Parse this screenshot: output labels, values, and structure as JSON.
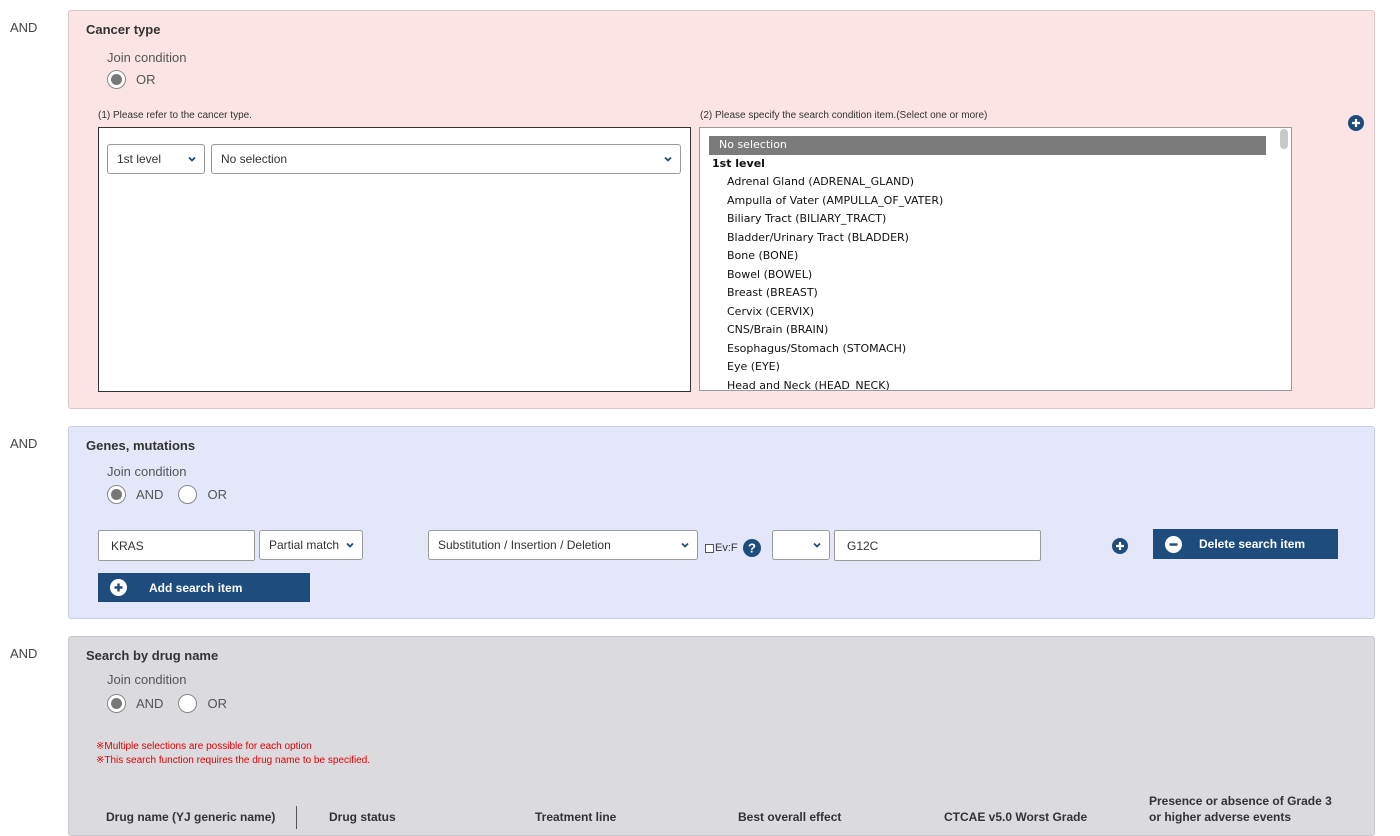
{
  "cancer_section": {
    "and_label": "AND",
    "title": "Cancer type",
    "join_label": "Join condition",
    "radio_or": "OR",
    "step1_label": "(1) Please refer to the cancer type.",
    "step2_label": "(2) Please specify the search condition item.(Select one or more)",
    "level_select": "1st level",
    "type_select": "No selection",
    "list_selected": "No selection",
    "list_group": "1st level",
    "list_items": [
      "Adrenal Gland (ADRENAL_GLAND)",
      "Ampulla of Vater (AMPULLA_OF_VATER)",
      "Biliary Tract (BILIARY_TRACT)",
      "Bladder/Urinary Tract (BLADDER)",
      "Bone (BONE)",
      "Bowel (BOWEL)",
      "Breast (BREAST)",
      "Cervix (CERVIX)",
      "CNS/Brain (BRAIN)",
      "Esophagus/Stomach (STOMACH)",
      "Eye (EYE)",
      "Head and Neck (HEAD_NECK)"
    ]
  },
  "genes_section": {
    "and_label": "AND",
    "title": "Genes, mutations",
    "join_label": "Join condition",
    "radio_and": "AND",
    "radio_or": "OR",
    "gene_value": "KRAS",
    "match_select": "Partial match",
    "mutation_select": "Substitution / Insertion / Deletion",
    "evf_label": "Ev:F",
    "blank_select": "",
    "variant_value": "G12C",
    "delete_button": "Delete search item",
    "add_button": "Add search item"
  },
  "drug_section": {
    "and_label": "AND",
    "title": "Search by drug name",
    "join_label": "Join condition",
    "radio_and": "AND",
    "radio_or": "OR",
    "note1": "※Multiple selections are possible for each option",
    "note2": "※This search function requires the drug name to be specified.",
    "columns": {
      "drug_name": "Drug name (YJ generic name)",
      "drug_status": "Drug status",
      "treatment_line": "Treatment line",
      "best_effect": "Best overall effect",
      "ctcae": "CTCAE v5.0 Worst Grade",
      "grade3_line1": "Presence or absence of Grade 3",
      "grade3_line2": "or higher adverse events"
    }
  },
  "colors": {
    "cancer_bg": "#fde4e4",
    "genes_bg": "#e4e7fa",
    "drug_bg": "#dadadf",
    "button_blue": "#1e4d7d",
    "note_red": "#e60000"
  }
}
